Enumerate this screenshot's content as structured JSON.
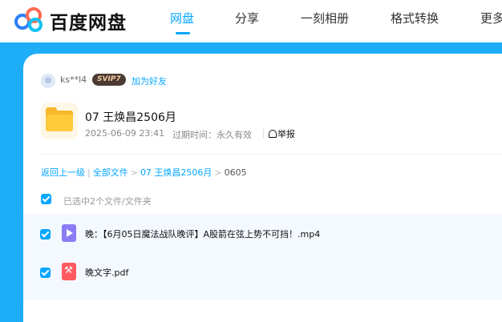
{
  "header": {
    "brand": "百度网盘",
    "nav": [
      "网盘",
      "分享",
      "一刻相册",
      "格式转换",
      "更多"
    ],
    "active_nav": "网盘"
  },
  "share": {
    "user": {
      "name": "ks**l4",
      "vip_badge": "SVIP7",
      "add_friend_label": "加为好友"
    },
    "folder": {
      "name": "07 王焕昌2506月",
      "date": "2025-06-09 23:41",
      "expire_label": "过期时间：永久有效",
      "report_label": "举报"
    }
  },
  "breadcrumb": {
    "back": "返回上一级",
    "all_files": "全部文件",
    "folder": "07 王焕昌2506月",
    "current": "0605",
    "separator": ">"
  },
  "selection": {
    "label": "已选中2个文件/文件夹"
  },
  "files": [
    {
      "name": "晚：【6月05日魔法战队晚评】A股箭在弦上势不可挡！.mp4",
      "type": "video-icon",
      "checked": true
    },
    {
      "name": "晚文字.pdf",
      "type": "pdf-icon",
      "checked": true
    }
  ],
  "colors": {
    "accent": "#06a7ff",
    "stage": "#1eaef7",
    "folder": "#ffcb3d",
    "video": "#8b7cf6",
    "pdf": "#ff5a5f"
  }
}
